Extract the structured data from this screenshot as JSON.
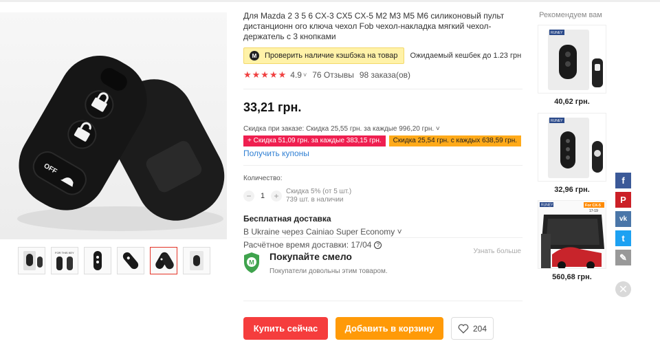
{
  "product": {
    "title": "Для Mazda 2 3 5 6 CX-3 CX5 CX-5 M2 M3 M5 M6 силиконовый пульт дистанционн ого ключа чехол Fob чехол-накладка мягкий чехол-держатель с 3 кнопками",
    "cashback_button": "Проверить наличие кэшбэка на товар",
    "cashback_badge": "M",
    "cashback_note": "Ожидаемый кешбек до 1.23 грн",
    "stars": "★★★★★",
    "rating": "4.9",
    "reviews": "76 Отзывы",
    "orders": "98 заказа(ов)",
    "price": "33,21 грн.",
    "order_discount": "Скидка при заказе: Скидка 25,55 грн. за каждые 996,20 грн. ˅",
    "coupons": [
      "+ Скидка 51,09 грн. за каждые 383,15 грн.",
      "Скидка 25,54 грн. с каждых 638,59 грн."
    ],
    "get_coupons": "Получить купоны",
    "quantity_label": "Количество:",
    "quantity_value": "1",
    "quantity_note": "Скидка 5% (от 5 шт.)",
    "stock_note": "739 шт. в наличии",
    "shipping_title": "Бесплатная доставка",
    "shipping_method": "В Ukraine через Cainiao Super Economy ˅",
    "delivery_time": "Расчётное время доставки: 17/04"
  },
  "buyer_protection": {
    "title": "Покупайте смело",
    "subtitle": "Покупатели довольны этим товаром.",
    "learn_more": "Узнать больше",
    "badge": "M"
  },
  "actions": {
    "buy_now": "Купить сейчас",
    "add_to_cart": "Добавить в корзину",
    "wishlist_count": "204"
  },
  "recommendations": {
    "title": "Рекомендуем вам",
    "brand_label": "RUNEY",
    "mat_label": "For CX-5",
    "mat_years": "17-19",
    "items": [
      {
        "price": "40,62 грн."
      },
      {
        "price": "32,96 грн."
      },
      {
        "price": "560,68 грн."
      }
    ]
  },
  "key_labels": {
    "off": "OFF"
  },
  "thumb_labels": {
    "t2": "FOR THIS KEY"
  },
  "share": [
    {
      "icon": "facebook-icon",
      "glyph": "f",
      "color": "#3b5998"
    },
    {
      "icon": "pinterest-icon",
      "glyph": "P",
      "color": "#cb2027"
    },
    {
      "icon": "vk-icon",
      "glyph": "vk",
      "color": "#4a76a8"
    },
    {
      "icon": "twitter-icon",
      "glyph": "t",
      "color": "#1da1f2"
    },
    {
      "icon": "edit-icon",
      "glyph": "✎",
      "color": "#999999"
    }
  ],
  "close_glyph": "✕",
  "colors": {
    "buy": "#f53d3d",
    "cart": "#ff9a08",
    "link": "#2f7fd3",
    "star": "#f04040"
  }
}
